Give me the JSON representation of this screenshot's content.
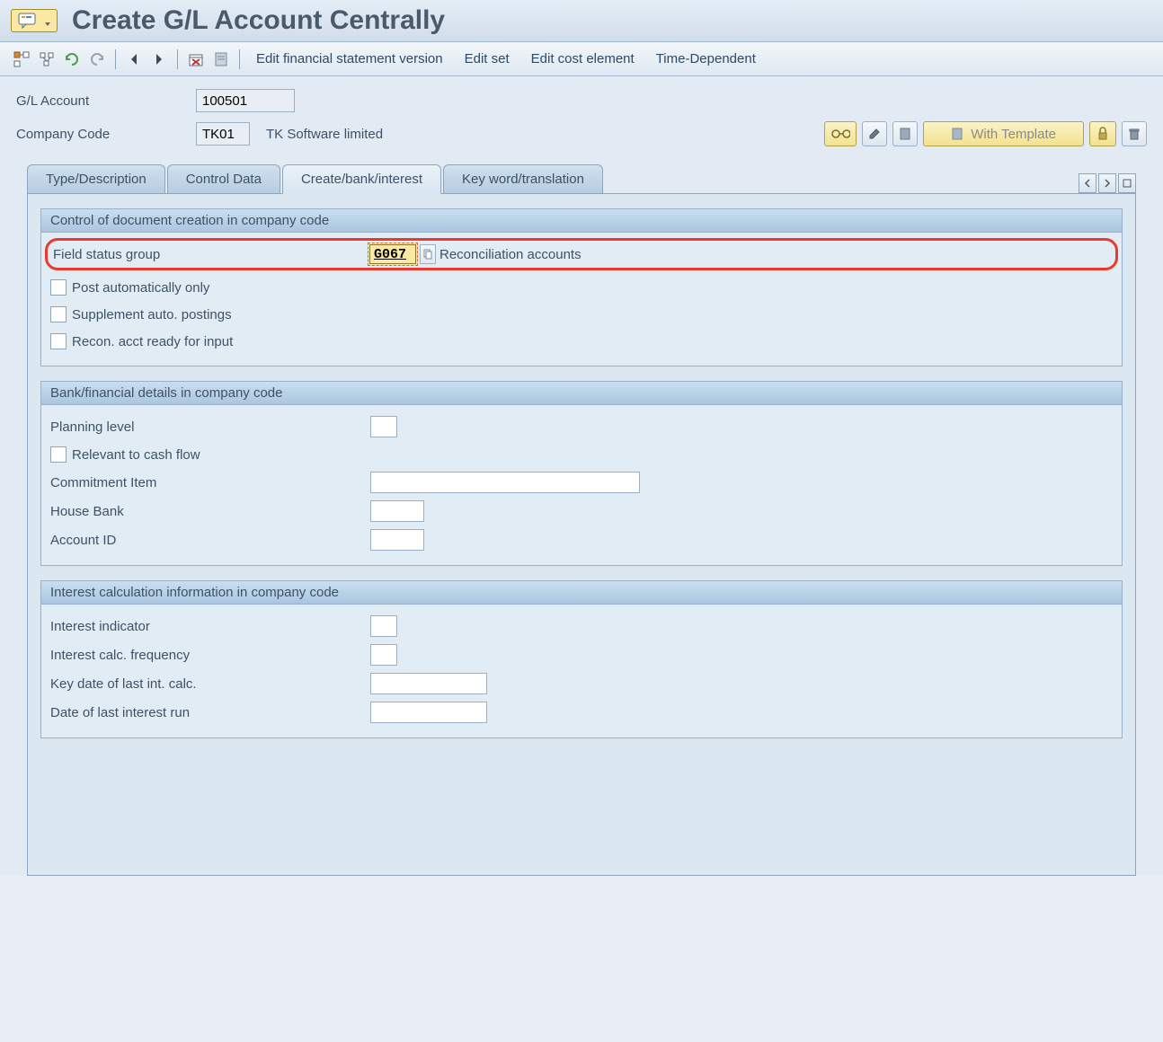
{
  "title": "Create G/L Account Centrally",
  "toolbar": {
    "links": [
      "Edit financial statement version",
      "Edit set",
      "Edit cost element",
      "Time-Dependent"
    ]
  },
  "header": {
    "gl_account_label": "G/L Account",
    "gl_account_value": "100501",
    "company_code_label": "Company Code",
    "company_code_value": "TK01",
    "company_code_desc": "TK Software limited",
    "with_template_label": "With Template"
  },
  "tabs": [
    "Type/Description",
    "Control Data",
    "Create/bank/interest",
    "Key word/translation"
  ],
  "group1": {
    "title": "Control of document creation in company code",
    "fsg_label": "Field status group",
    "fsg_value": "G067",
    "fsg_desc": "Reconciliation accounts",
    "chk_post_auto": "Post automatically only",
    "chk_supp": "Supplement auto. postings",
    "chk_recon": "Recon. acct ready for input"
  },
  "group2": {
    "title": "Bank/financial details in company code",
    "planning_level": "Planning level",
    "relevant_cashflow": "Relevant to cash flow",
    "commitment_item": "Commitment Item",
    "house_bank": "House Bank",
    "account_id": "Account ID"
  },
  "group3": {
    "title": "Interest calculation information in company code",
    "interest_indicator": "Interest indicator",
    "interest_freq": "Interest calc. frequency",
    "key_date": "Key date of last int. calc.",
    "date_last_run": "Date of last interest run"
  }
}
